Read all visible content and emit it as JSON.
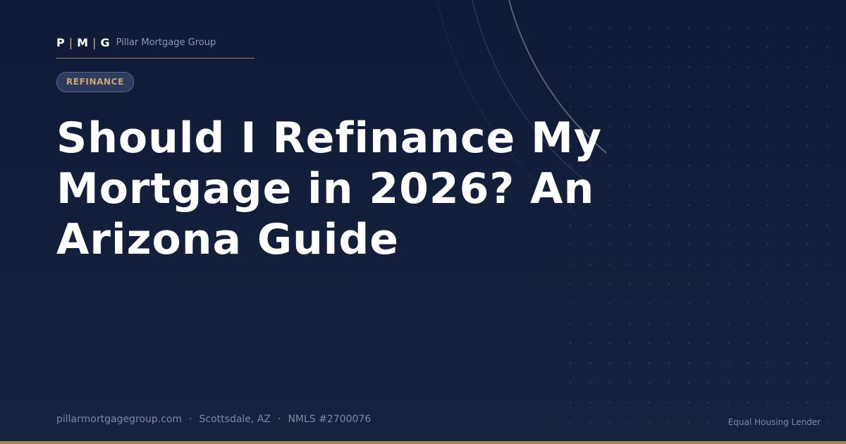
{
  "brand": {
    "logo_letters": [
      "P",
      "M",
      "G"
    ],
    "logo_separator": "|",
    "name": "Pillar Mortgage Group"
  },
  "badge": {
    "label": "REFINANCE"
  },
  "headline": {
    "text": "Should I Refinance My Mortgage in 2026? An Arizona Guide"
  },
  "footer": {
    "website": "pillarmortgagegroup.com",
    "separator": "·",
    "location": "Scottsdale, AZ",
    "nmls": "NMLS #2700076",
    "disclaimer": "Equal Housing Lender"
  },
  "colors": {
    "background_top": "#0f1b36",
    "background_bottom": "#16223f",
    "accent_gold": "#c9a96b",
    "muted_text": "#7d89a4",
    "badge_bg": "#2c3b5e"
  }
}
